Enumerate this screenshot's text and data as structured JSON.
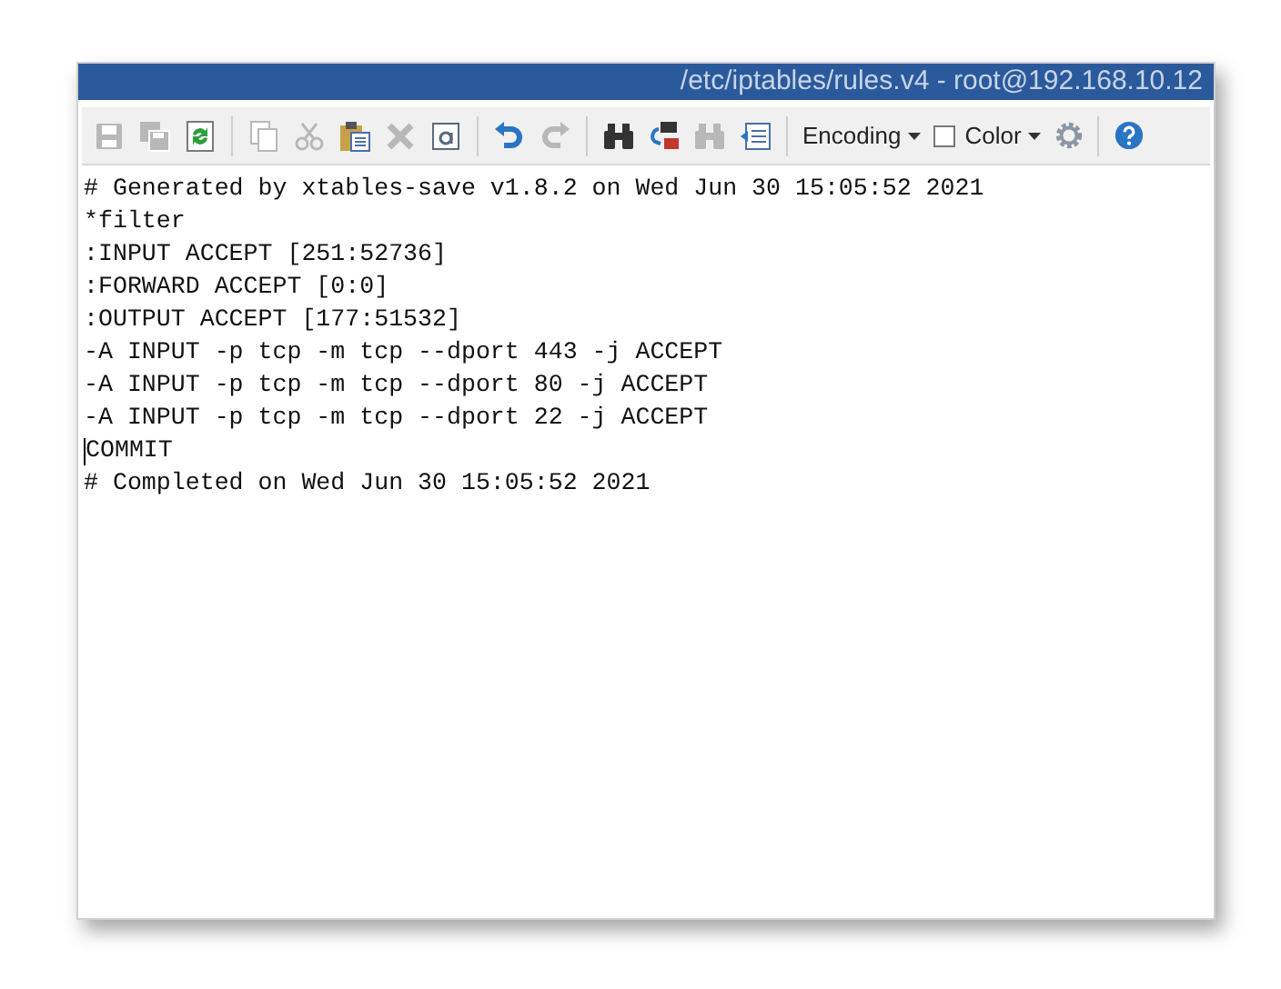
{
  "window": {
    "title": "/etc/iptables/rules.v4 - root@192.168.10.12"
  },
  "toolbar": {
    "buttons": [
      {
        "kind": "save",
        "disabled": true
      },
      {
        "kind": "save-all",
        "disabled": true
      },
      {
        "kind": "refresh",
        "disabled": false
      },
      {
        "kind": "separator"
      },
      {
        "kind": "copy",
        "disabled": true
      },
      {
        "kind": "cut",
        "disabled": true
      },
      {
        "kind": "paste",
        "disabled": false
      },
      {
        "kind": "delete",
        "disabled": true
      },
      {
        "kind": "select-all",
        "disabled": false
      },
      {
        "kind": "separator"
      },
      {
        "kind": "undo",
        "disabled": false
      },
      {
        "kind": "redo",
        "disabled": true
      },
      {
        "kind": "separator"
      },
      {
        "kind": "find",
        "disabled": false
      },
      {
        "kind": "replace",
        "disabled": false
      },
      {
        "kind": "find-next",
        "disabled": true
      },
      {
        "kind": "goto",
        "disabled": false
      },
      {
        "kind": "separator"
      }
    ],
    "encoding": {
      "label": "Encoding"
    },
    "color": {
      "label": "Color",
      "checked": false
    },
    "settings": {
      "disabled": false
    },
    "help": {
      "disabled": false
    }
  },
  "editor": {
    "lines": [
      {
        "text": "# Generated by xtables-save v1.8.2 on Wed Jun 30 15:05:52 2021",
        "cursor": false
      },
      {
        "text": "*filter",
        "cursor": false
      },
      {
        "text": ":INPUT ACCEPT [251:52736]",
        "cursor": false
      },
      {
        "text": ":FORWARD ACCEPT [0:0]",
        "cursor": false
      },
      {
        "text": ":OUTPUT ACCEPT [177:51532]",
        "cursor": false
      },
      {
        "text": "-A INPUT -p tcp -m tcp --dport 443 -j ACCEPT",
        "cursor": false
      },
      {
        "text": "-A INPUT -p tcp -m tcp --dport 80 -j ACCEPT",
        "cursor": false
      },
      {
        "text": "-A INPUT -p tcp -m tcp --dport 22 -j ACCEPT",
        "cursor": false
      },
      {
        "text": "COMMIT",
        "cursor": true
      },
      {
        "text": "# Completed on Wed Jun 30 15:05:52 2021",
        "cursor": false
      }
    ]
  }
}
